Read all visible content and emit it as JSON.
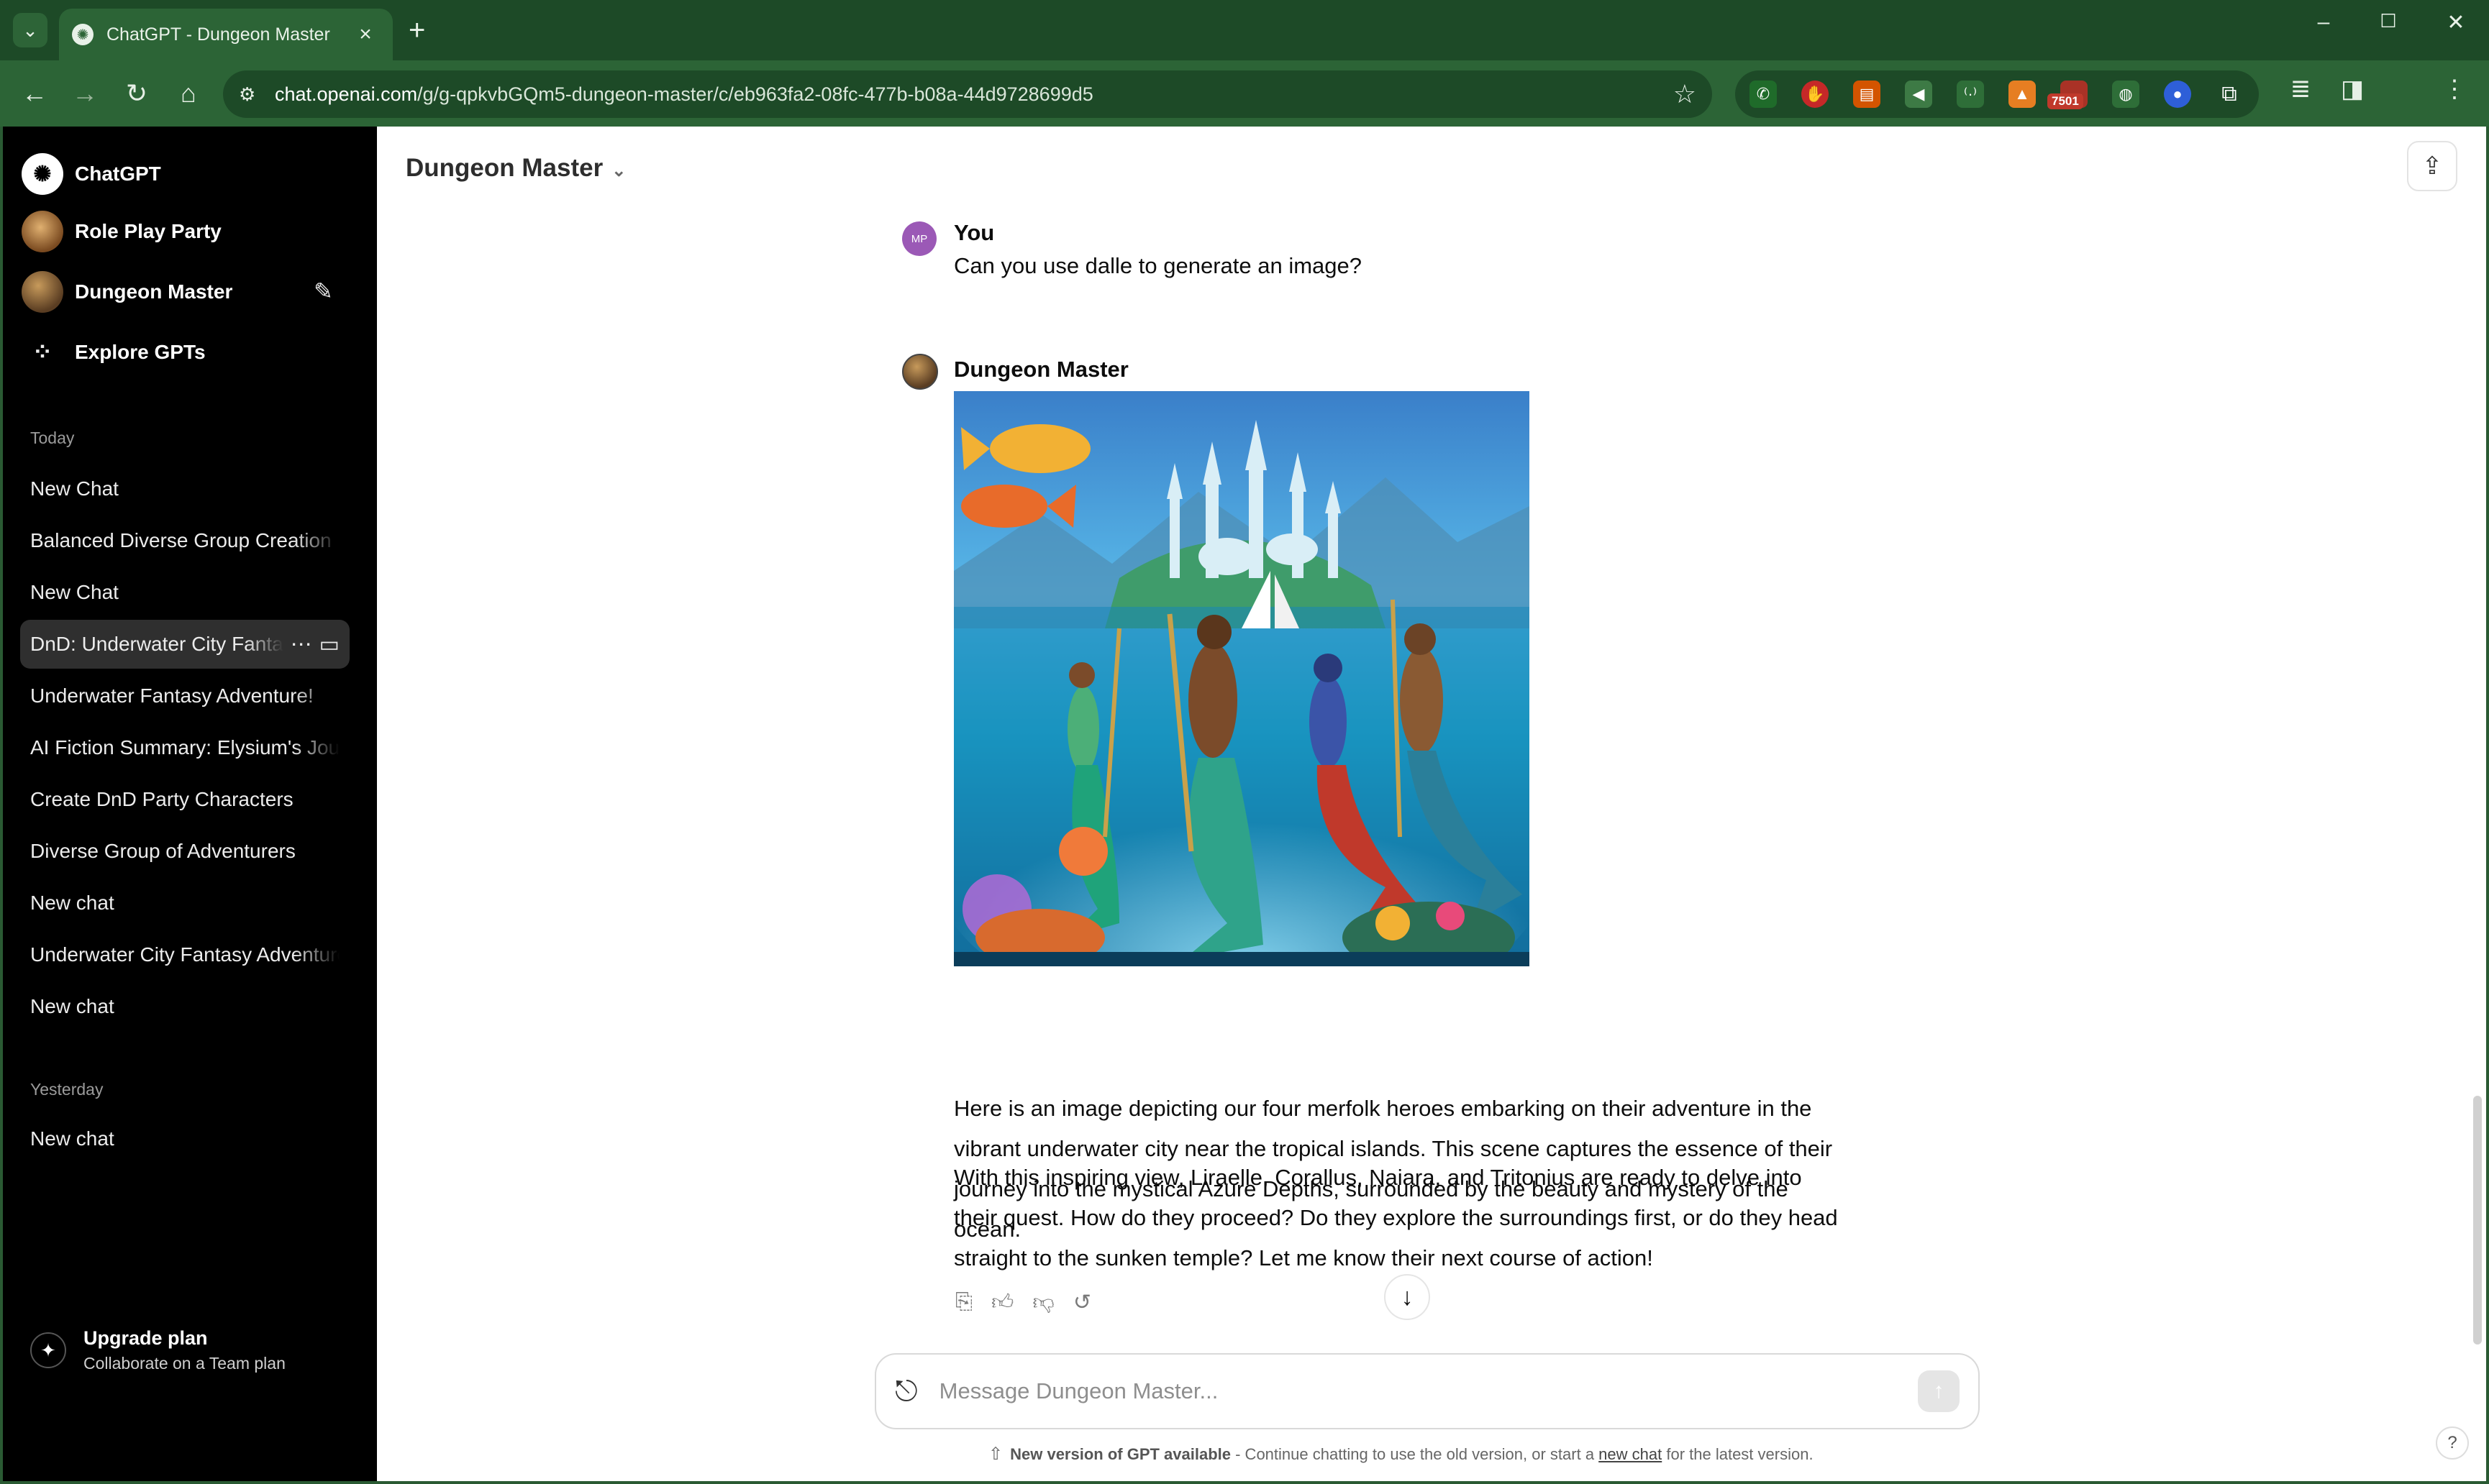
{
  "browser": {
    "tab_title": "ChatGPT - Dungeon Master",
    "url_host": "chat.openai.com",
    "url_path": "/g/g-qpkvbGQm5-dungeon-master/c/eb963fa2-08fc-477b-b08a-44d9728699d5",
    "extension_badge": "7501"
  },
  "sidebar": {
    "top": [
      {
        "label": "ChatGPT",
        "icon": "openai-logo-icon"
      },
      {
        "label": "Role Play Party",
        "icon": "gpt-avatar"
      },
      {
        "label": "Dungeon Master",
        "icon": "gpt-avatar"
      },
      {
        "label": "Explore GPTs",
        "icon": "grid-icon"
      }
    ],
    "section_today": "Today",
    "today": [
      {
        "label": "New Chat"
      },
      {
        "label": "Balanced Diverse Group Creation"
      },
      {
        "label": "New Chat"
      },
      {
        "label": "DnD: Underwater City Fantasy",
        "active": true
      },
      {
        "label": "Underwater Fantasy Adventure!"
      },
      {
        "label": "AI Fiction Summary: Elysium's Journey"
      },
      {
        "label": "Create DnD Party Characters"
      },
      {
        "label": "Diverse Group of Adventurers"
      },
      {
        "label": "New chat"
      },
      {
        "label": "Underwater City Fantasy Adventure"
      },
      {
        "label": "New chat"
      }
    ],
    "section_yesterday": "Yesterday",
    "yesterday": [
      {
        "label": "New chat"
      }
    ],
    "upgrade_title": "Upgrade plan",
    "upgrade_subtitle": "Collaborate on a Team plan"
  },
  "header": {
    "title": "Dungeon Master"
  },
  "conversation": {
    "user_initials": "MP",
    "user_name": "You",
    "user_message": "Can you use dalle to generate an image?",
    "assistant_name": "Dungeon Master",
    "image_alt": "Underwater city with four merfolk heroes",
    "paragraph_1": "Here is an image depicting our four merfolk heroes embarking on their adventure in the vibrant underwater city near the tropical islands. This scene captures the essence of their journey into the mystical Azure Depths, surrounded by the beauty and mystery of the ocean.",
    "paragraph_2": "With this inspiring view, Liraelle, Corallus, Naiara, and Tritonius are ready to delve into their quest. How do they proceed? Do they explore the surroundings first, or do they head straight to the sunken temple? Let me know their next course of action!"
  },
  "composer": {
    "placeholder": "Message Dungeon Master..."
  },
  "notice": {
    "bold": "New version of GPT available",
    "text_1": " - Continue chatting to use the old version, or start a ",
    "link": "new chat",
    "text_2": " for the latest version."
  },
  "help_label": "?"
}
